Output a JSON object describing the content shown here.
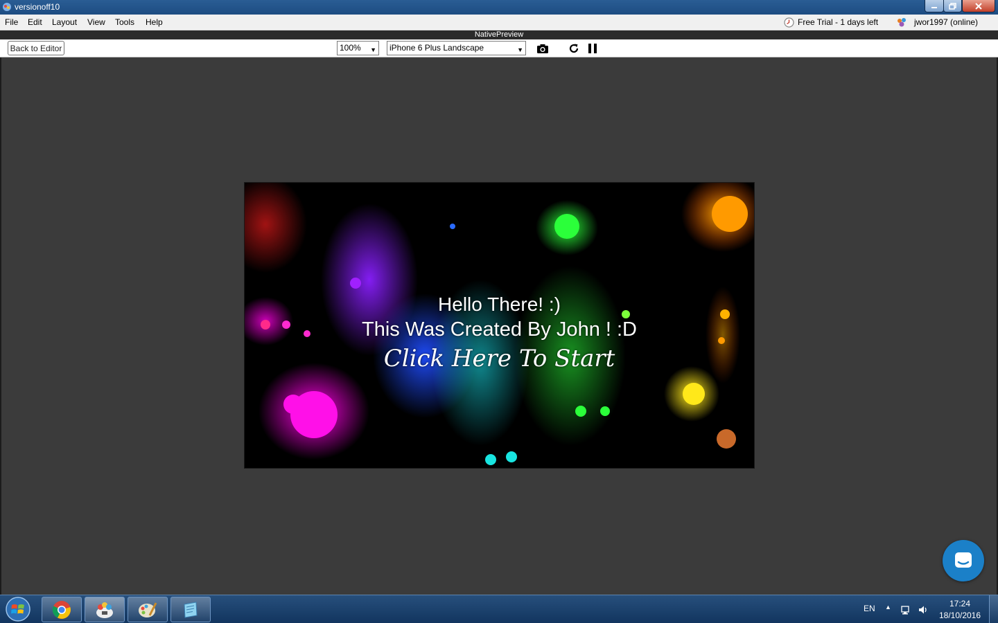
{
  "window": {
    "title": "versionoff10",
    "controls": {
      "minimize": "minimize-icon",
      "maximize": "restore-icon",
      "close": "close-icon"
    }
  },
  "menu": {
    "items": [
      "File",
      "Edit",
      "Layout",
      "View",
      "Tools",
      "Help"
    ],
    "trial_text": "Free Trial - 1 days left",
    "trial_icon": "clock-icon",
    "user_text": "jwor1997 (online)",
    "user_icon": "user-status-icon"
  },
  "preview": {
    "panel_title": "NativePreview",
    "back_label": "Back to Editor",
    "zoom_value": "100%",
    "device_value": "iPhone 6 Plus Landscape",
    "tools": [
      "camera-icon",
      "refresh-icon",
      "pause-icon"
    ]
  },
  "screen": {
    "line1": "Hello There! :)",
    "line2": "This Was Created By John  ! :D",
    "line3": "Click Here To Start"
  },
  "chat_button": {
    "icon": "chat-icon",
    "color": "#1b80c8"
  },
  "taskbar": {
    "start_icon": "windows-start-icon",
    "apps": [
      "chrome-icon",
      "app-builder-icon",
      "paint-icon",
      "notepad-icon"
    ],
    "language": "EN",
    "time": "17:24",
    "date": "18/10/2016"
  },
  "colors": {
    "workspace": "#3b3b3b",
    "titlebar": "#1d4c82",
    "taskbar": "#12355f"
  }
}
